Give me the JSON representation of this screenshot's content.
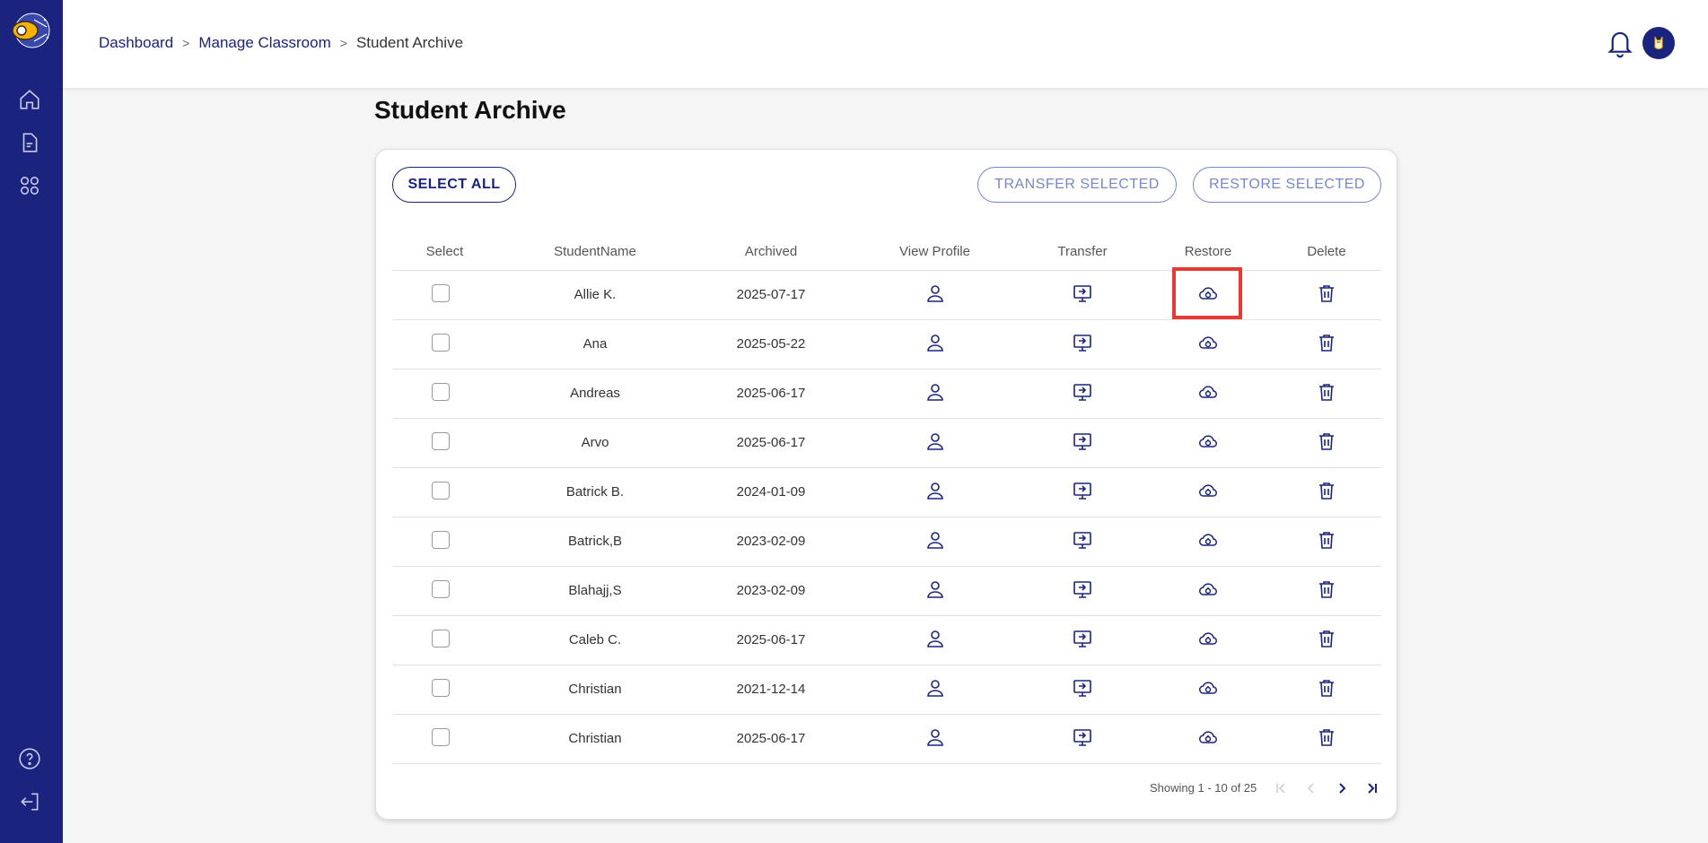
{
  "app": {
    "brand_colors": {
      "sidebar": "#1a237e",
      "accent": "#1a237e",
      "highlight": "#e53935"
    }
  },
  "sidebar": {
    "icons": [
      "home-icon",
      "document-icon",
      "apps-grid-icon",
      "help-icon",
      "logout-icon"
    ]
  },
  "breadcrumb": {
    "items": [
      "Dashboard",
      "Manage Classroom"
    ],
    "separator": ">",
    "current": "Student Archive"
  },
  "page": {
    "title": "Student Archive"
  },
  "actions": {
    "select_all": "SELECT ALL",
    "transfer_selected": "TRANSFER SELECTED",
    "restore_selected": "RESTORE SELECTED"
  },
  "table": {
    "headers": [
      "Select",
      "StudentName",
      "Archived",
      "View Profile",
      "Transfer",
      "Restore",
      "Delete"
    ],
    "rows": [
      {
        "name": "Allie K.",
        "archived": "2025-07-17"
      },
      {
        "name": "Ana",
        "archived": "2025-05-22"
      },
      {
        "name": "Andreas",
        "archived": "2025-06-17"
      },
      {
        "name": "Arvo",
        "archived": "2025-06-17"
      },
      {
        "name": "Batrick B.",
        "archived": "2024-01-09"
      },
      {
        "name": "Batrick,B",
        "archived": "2023-02-09"
      },
      {
        "name": "Blahajj,S",
        "archived": "2023-02-09"
      },
      {
        "name": "Caleb C.",
        "archived": "2025-06-17"
      },
      {
        "name": "Christian",
        "archived": "2021-12-14"
      },
      {
        "name": "Christian",
        "archived": "2025-06-17"
      }
    ]
  },
  "pagination": {
    "text": "Showing 1 - 10 of 25"
  }
}
